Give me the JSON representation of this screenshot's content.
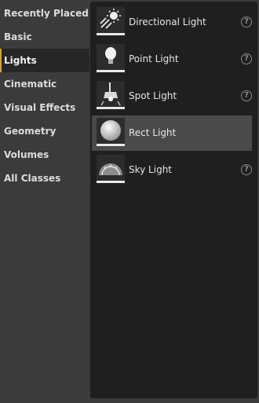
{
  "categories": [
    {
      "label": "Recently Placed"
    },
    {
      "label": "Basic"
    },
    {
      "label": "Lights"
    },
    {
      "label": "Cinematic"
    },
    {
      "label": "Visual Effects"
    },
    {
      "label": "Geometry"
    },
    {
      "label": "Volumes"
    },
    {
      "label": "All Classes"
    }
  ],
  "selected_category": "Lights",
  "items": [
    {
      "label": "Directional Light",
      "icon": "directional-light-icon",
      "help": "?"
    },
    {
      "label": "Point Light",
      "icon": "point-light-icon",
      "help": "?"
    },
    {
      "label": "Spot Light",
      "icon": "spot-light-icon",
      "help": "?"
    },
    {
      "label": "Rect Light",
      "icon": "rect-light-icon"
    },
    {
      "label": "Sky Light",
      "icon": "sky-light-icon",
      "help": "?"
    }
  ],
  "selected_item": "Rect Light",
  "colors": {
    "accent": "#e8a000",
    "panel": "#1f1f1f",
    "sidebar": "#3b3b3b"
  }
}
